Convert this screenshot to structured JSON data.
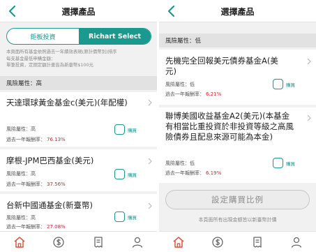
{
  "colors": {
    "accent": "#1a9a8f",
    "return": "#d8232a",
    "home_active": "#e0533b"
  },
  "left": {
    "title": "選擇產品",
    "toggle": {
      "option1": "鉅板投資",
      "option2": "Richart Select"
    },
    "note": {
      "line1": "本頁面所有基金依照過去一年績效表現(原計價幣別)排序",
      "line2": "每支基金最低申購金額：",
      "line3": "單筆投資，定期定額計畫皆為新臺幣$100元"
    },
    "section": "風險屬性：高",
    "cards": [
      {
        "name": "天達環球黃金基金c(美元)(年配權)",
        "risk": "風險屬性：高",
        "return_label": "過去一年報酬率：",
        "return_value": "76.13%",
        "buy": "購買"
      },
      {
        "name": "摩根-JPM巴西基金(美元)",
        "risk": "風險屬性：高",
        "return_label": "過去一年報酬率：",
        "return_value": "37.56%",
        "buy": "購買"
      },
      {
        "name": "台新中國通基金(新臺幣)",
        "risk": "風險屬性：高",
        "return_label": "過去一年報酬率：",
        "return_value": "27.08%",
        "buy": "購買"
      }
    ],
    "tabs": [
      "home-icon",
      "dollar-icon",
      "receipt-icon",
      "user-icon"
    ]
  },
  "right": {
    "title": "選擇產品",
    "section": "風險屬性：低",
    "cards": [
      {
        "name": "先機完全回報美元債券基金A(美元)",
        "risk": "風險屬性：低",
        "return_label": "過去一年報酬率：",
        "return_value": "6.21%",
        "buy": "購買"
      },
      {
        "name": "聯博美國收益基金A2(美元)(本基金有相當比重投資於非投資等級之高風險債券且配息來源可能為本金)",
        "risk": "風險屬性：低",
        "return_label": "過去一年報酬率：",
        "return_value": "6.19%",
        "buy": "購買"
      }
    ],
    "allocate_button": "設定購買比例",
    "footer_note": "本頁面所有出現金額皆以新臺幣計價",
    "tabs": [
      "home-icon",
      "dollar-icon",
      "receipt-icon",
      "user-icon"
    ]
  }
}
